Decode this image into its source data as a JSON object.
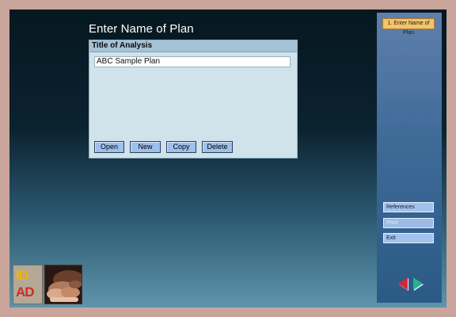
{
  "page": {
    "title": "Enter Name of Plan"
  },
  "panel": {
    "header": "Title of Analysis",
    "plan_name_value": "ABC Sample Plan",
    "buttons": {
      "open": "Open",
      "new": "New",
      "copy": "Copy",
      "delete": "Delete"
    }
  },
  "sidebar": {
    "current_step": "1. Enter Name of Plan",
    "buttons": {
      "references": "References",
      "print": "Print",
      "exit": "Exit"
    },
    "nav": {
      "prev_icon": "left-triangle-icon",
      "next_icon": "right-triangle-icon"
    }
  },
  "logo": {
    "line1": "ID",
    "line2": "AD"
  },
  "colors": {
    "frame": "#c9a59b",
    "accent_step": "#f3c46a",
    "button": "#9ec0ec",
    "prev_arrow": "#d6263a",
    "next_arrow": "#27b08e"
  }
}
